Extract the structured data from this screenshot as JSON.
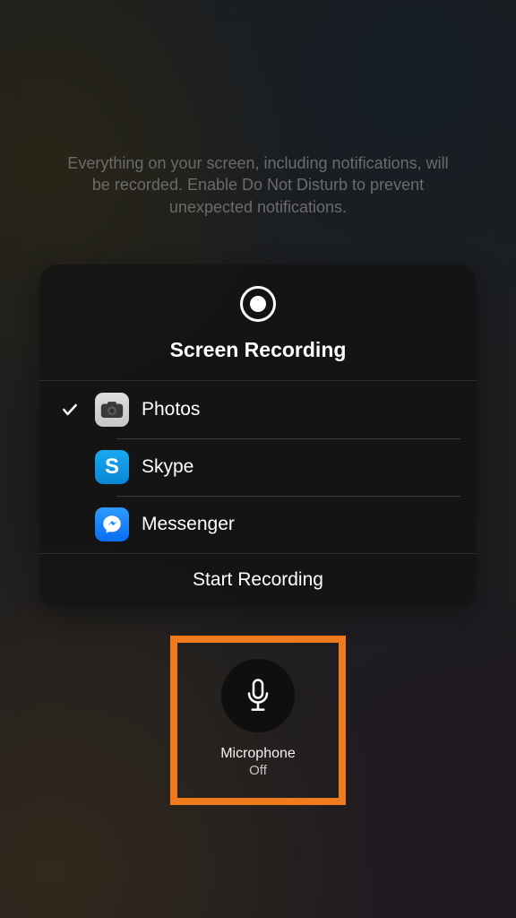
{
  "hint": "Everything on your screen, including notifications, will be recorded. Enable Do Not Disturb to prevent unexpected notifications.",
  "panel": {
    "title": "Screen Recording",
    "apps": [
      {
        "label": "Photos",
        "selected": true
      },
      {
        "label": "Skype",
        "selected": false
      },
      {
        "label": "Messenger",
        "selected": false
      }
    ],
    "start_label": "Start Recording"
  },
  "mic": {
    "title": "Microphone",
    "status": "Off"
  },
  "highlight_color": "#f07a1c"
}
